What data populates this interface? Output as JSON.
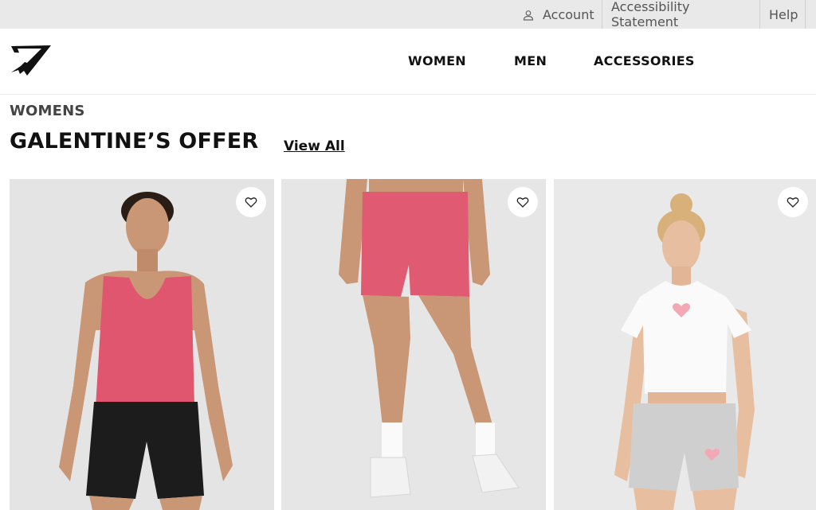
{
  "utility": {
    "account_label": "Account",
    "accessibility_label": "Accessibility Statement",
    "help_label": "Help"
  },
  "header": {
    "logo_icon": "gymshark-shark-logo",
    "nav": [
      {
        "label": "WOMEN"
      },
      {
        "label": "MEN"
      },
      {
        "label": "ACCESSORIES"
      }
    ]
  },
  "section": {
    "eyebrow": "WOMENS",
    "title": "GALENTINE’S OFFER",
    "view_all_label": "View All"
  },
  "products": [
    {
      "image_alt": "Woman in pink seamless tank and black shorts",
      "wishlist_icon": "heart-icon"
    },
    {
      "image_alt": "Pink seamless cycling shorts with white trainers",
      "wishlist_icon": "heart-icon"
    },
    {
      "image_alt": "Woman in white cropped tee with heart print and grey shorts",
      "wishlist_icon": "heart-icon"
    }
  ],
  "colors": {
    "utility_bg": "#e9e9e9",
    "card_bg": "#e6e6e6",
    "accent_pink": "#e0566e",
    "text": "#111111"
  }
}
